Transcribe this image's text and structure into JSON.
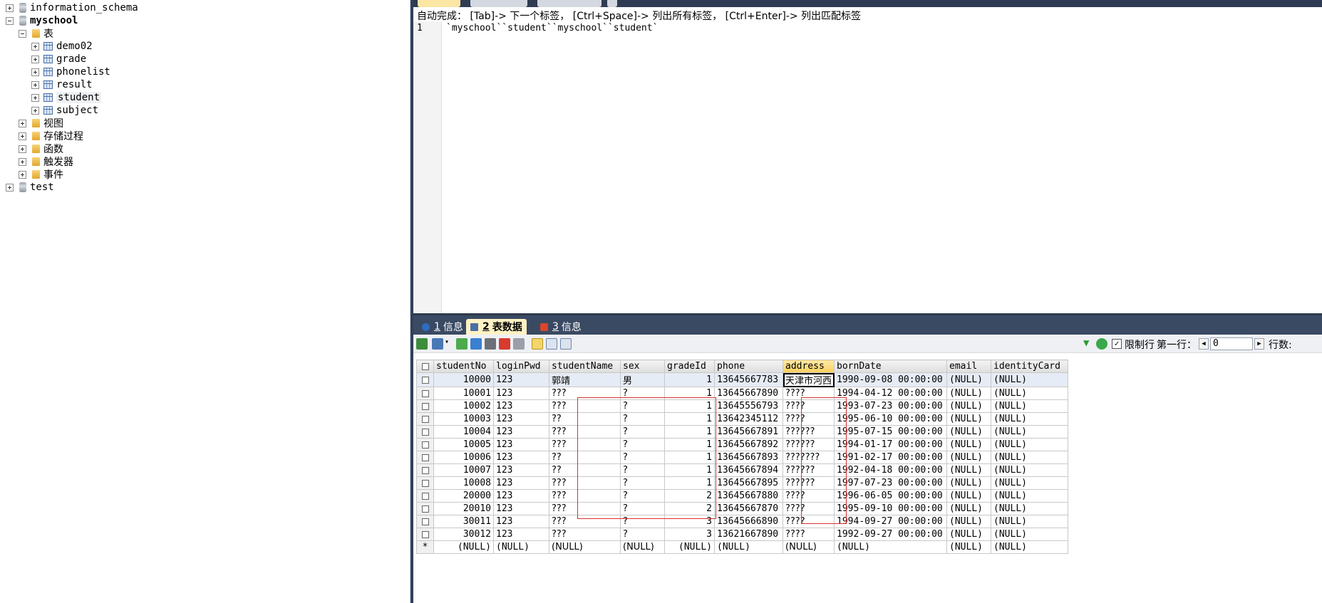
{
  "tree": {
    "nodes": [
      {
        "label": "information_schema",
        "type": "db",
        "expander": "plus",
        "indent": 0,
        "bold": false
      },
      {
        "label": "myschool",
        "type": "db",
        "expander": "minus",
        "indent": 0,
        "bold": true
      },
      {
        "label": "表",
        "type": "folder",
        "expander": "minus",
        "indent": 1,
        "cn": true
      },
      {
        "label": "demo02",
        "type": "table",
        "expander": "plus",
        "indent": 2
      },
      {
        "label": "grade",
        "type": "table",
        "expander": "plus",
        "indent": 2
      },
      {
        "label": "phonelist",
        "type": "table",
        "expander": "plus",
        "indent": 2
      },
      {
        "label": "result",
        "type": "table",
        "expander": "plus",
        "indent": 2
      },
      {
        "label": "student",
        "type": "table",
        "expander": "plus",
        "indent": 2,
        "selected": true
      },
      {
        "label": "subject",
        "type": "table",
        "expander": "plus",
        "indent": 2
      },
      {
        "label": "视图",
        "type": "folder",
        "expander": "plus",
        "indent": 1,
        "cn": true
      },
      {
        "label": "存储过程",
        "type": "folder",
        "expander": "plus",
        "indent": 1,
        "cn": true
      },
      {
        "label": "函数",
        "type": "folder",
        "expander": "plus",
        "indent": 1,
        "cn": true
      },
      {
        "label": "触发器",
        "type": "folder",
        "expander": "plus",
        "indent": 1,
        "cn": true
      },
      {
        "label": "事件",
        "type": "folder",
        "expander": "plus",
        "indent": 1,
        "cn": true
      },
      {
        "label": "test",
        "type": "db",
        "expander": "plus",
        "indent": 0
      }
    ]
  },
  "editor": {
    "hint": "自动完成： [Tab]-> 下一个标签， [Ctrl+Space]-> 列出所有标签， [Ctrl+Enter]-> 列出匹配标签",
    "line_number": "1",
    "code": "`myschool``student``myschool``student`"
  },
  "result_tabs": [
    {
      "num": "1",
      "label": "信息",
      "icon_color": "#2d6cc0"
    },
    {
      "num": "2",
      "label": "表数据",
      "icon_color": "#4a6fa5",
      "active": true
    },
    {
      "num": "3",
      "label": "信息",
      "icon_color": "#d9462b"
    }
  ],
  "toolbar": {
    "limit_label": "限制行",
    "first_row_label": "第一行：",
    "first_row_value": "0",
    "rows_label": "行数:"
  },
  "grid": {
    "columns": [
      "studentNo",
      "loginPwd",
      "studentName",
      "sex",
      "gradeId",
      "phone",
      "address",
      "bornDate",
      "email",
      "identityCard"
    ],
    "sorted_column": "address",
    "rows": [
      [
        "10000",
        "123",
        "郭靖",
        "男",
        "1",
        "13645667783",
        "天津市河西",
        "1990-09-08 00:00:00",
        "(NULL)",
        "(NULL)"
      ],
      [
        "10001",
        "123",
        "???",
        "?",
        "1",
        "13645667890",
        "????",
        "1994-04-12 00:00:00",
        "(NULL)",
        "(NULL)"
      ],
      [
        "10002",
        "123",
        "???",
        "?",
        "1",
        "13645556793",
        "????",
        "1993-07-23 00:00:00",
        "(NULL)",
        "(NULL)"
      ],
      [
        "10003",
        "123",
        "??",
        "?",
        "1",
        "13642345112",
        "????",
        "1995-06-10 00:00:00",
        "(NULL)",
        "(NULL)"
      ],
      [
        "10004",
        "123",
        "???",
        "?",
        "1",
        "13645667891",
        "??????",
        "1995-07-15 00:00:00",
        "(NULL)",
        "(NULL)"
      ],
      [
        "10005",
        "123",
        "???",
        "?",
        "1",
        "13645667892",
        "??????",
        "1994-01-17 00:00:00",
        "(NULL)",
        "(NULL)"
      ],
      [
        "10006",
        "123",
        "??",
        "?",
        "1",
        "13645667893",
        "???????",
        "1991-02-17 00:00:00",
        "(NULL)",
        "(NULL)"
      ],
      [
        "10007",
        "123",
        "??",
        "?",
        "1",
        "13645667894",
        "??????",
        "1992-04-18 00:00:00",
        "(NULL)",
        "(NULL)"
      ],
      [
        "10008",
        "123",
        "???",
        "?",
        "1",
        "13645667895",
        "??????",
        "1997-07-23 00:00:00",
        "(NULL)",
        "(NULL)"
      ],
      [
        "20000",
        "123",
        "???",
        "?",
        "2",
        "13645667880",
        "????",
        "1996-06-05 00:00:00",
        "(NULL)",
        "(NULL)"
      ],
      [
        "20010",
        "123",
        "???",
        "?",
        "2",
        "13645667870",
        "????",
        "1995-09-10 00:00:00",
        "(NULL)",
        "(NULL)"
      ],
      [
        "30011",
        "123",
        "???",
        "?",
        "3",
        "13645666890",
        "????",
        "1994-09-27 00:00:00",
        "(NULL)",
        "(NULL)"
      ],
      [
        "30012",
        "123",
        "???",
        "?",
        "3",
        "13621667890",
        "????",
        "1992-09-27 00:00:00",
        "(NULL)",
        "(NULL)"
      ]
    ],
    "new_row_marker": "*",
    "new_row": [
      "(NULL)",
      "(NULL)",
      "(NULL)",
      "(NULL)",
      "(NULL)",
      "(NULL)",
      "(NULL)",
      "(NULL)",
      "(NULL)",
      "(NULL)"
    ]
  },
  "colors": {
    "highlight_box": "#e03030",
    "active_tab": "#fff2c4",
    "header_sorted": "#f7cf5b"
  }
}
